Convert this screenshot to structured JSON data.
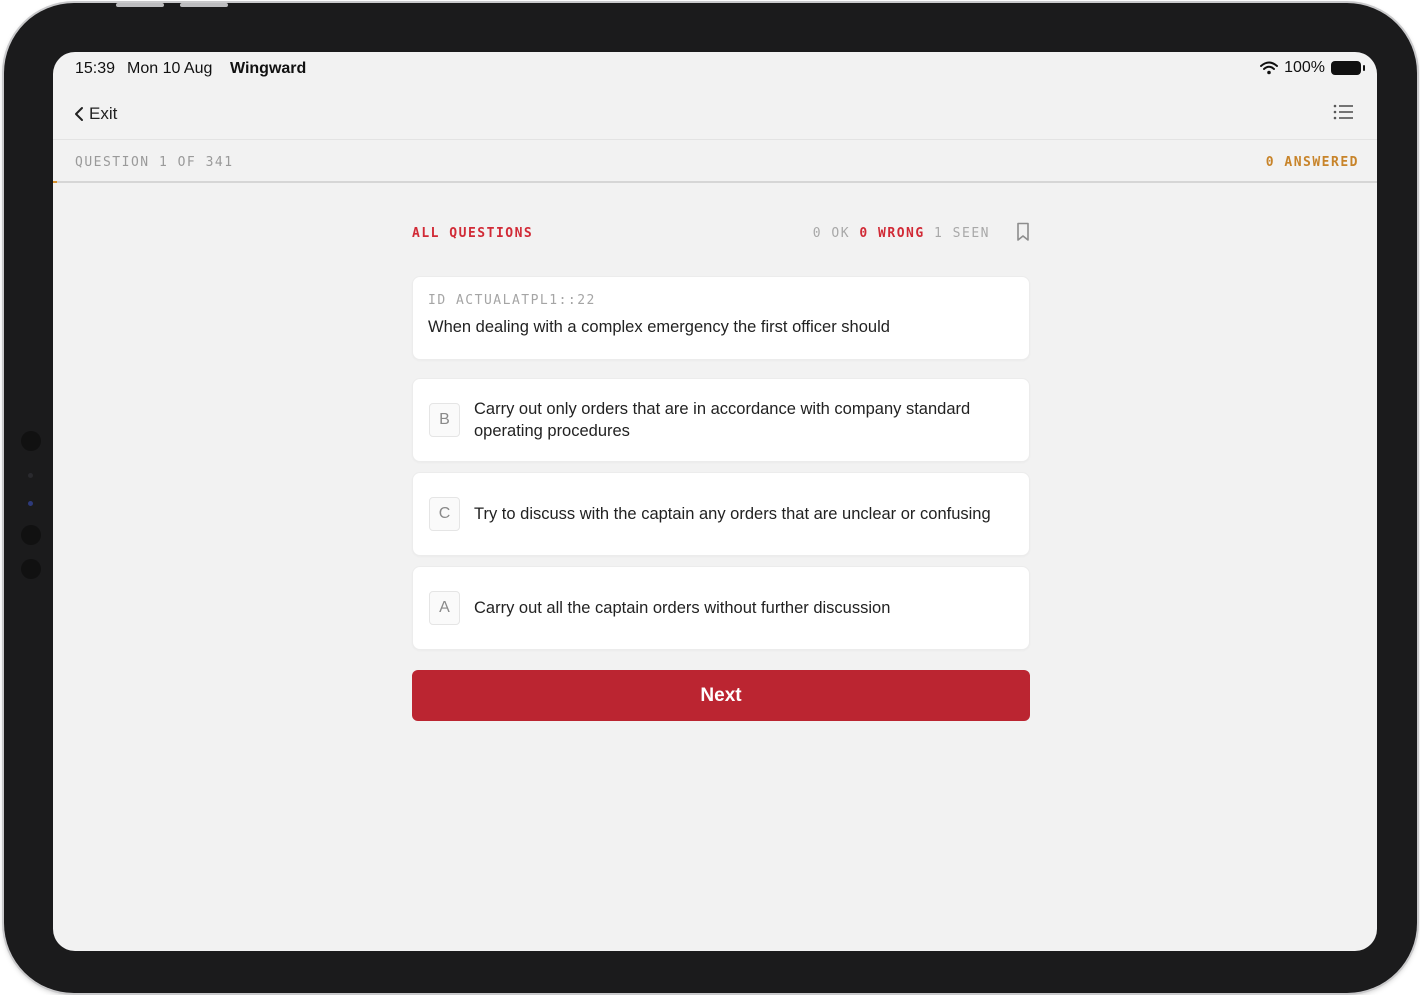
{
  "status_bar": {
    "time": "15:39",
    "date": "Mon 10 Aug",
    "app_name": "Wingward",
    "battery": "100%"
  },
  "nav": {
    "back_label": "Exit"
  },
  "progress": {
    "question_label": "QUESTION 1 OF 341",
    "answered_label": "0 ANSWERED",
    "fraction": 0.003
  },
  "quiz": {
    "filter_label": "ALL QUESTIONS",
    "stats": {
      "ok": "0 OK",
      "wrong": "0 WRONG",
      "seen": "1 SEEN"
    },
    "question": {
      "id": "ID ACTUALATPL1::22",
      "text": "When dealing with a complex emergency the first officer should"
    },
    "options": [
      {
        "letter": "B",
        "text": "Carry out only orders that are in accordance with company standard operating procedures"
      },
      {
        "letter": "C",
        "text": "Try to discuss with the captain any orders that are unclear or confusing"
      },
      {
        "letter": "A",
        "text": "Carry out all the captain orders without further discussion"
      }
    ],
    "next_label": "Next"
  },
  "colors": {
    "accent_red": "#bb2531",
    "accent_orange": "#c8842a"
  }
}
